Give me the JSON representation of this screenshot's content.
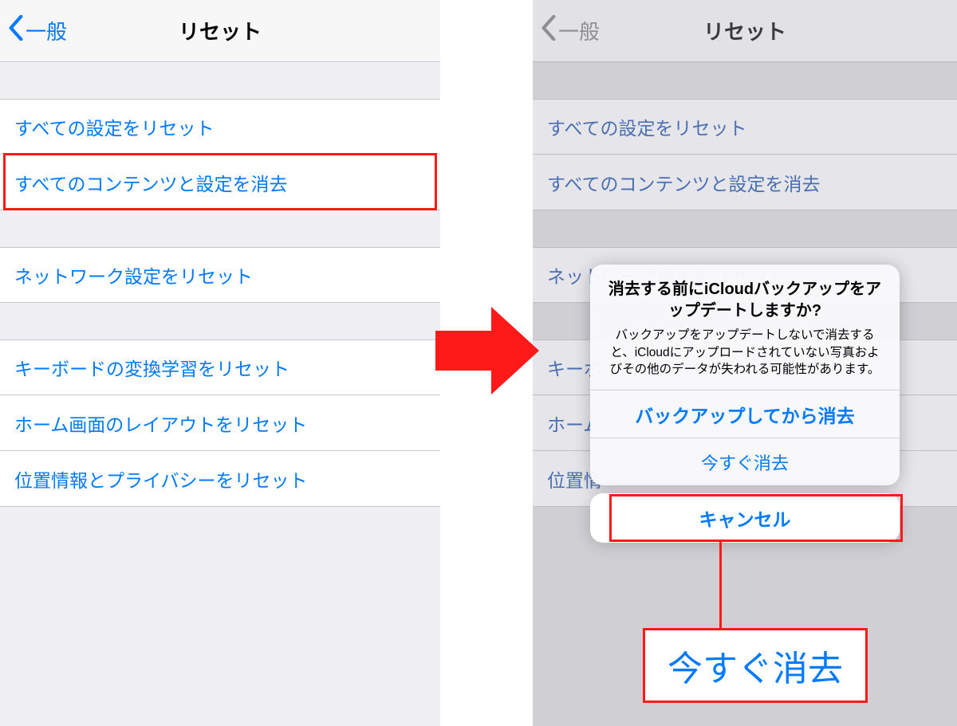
{
  "left": {
    "back_label": "一般",
    "title": "リセット",
    "group1": [
      "すべての設定をリセット",
      "すべてのコンテンツと設定を消去"
    ],
    "group2": [
      "ネットワーク設定をリセット"
    ],
    "group3": [
      "キーボードの変換学習をリセット",
      "ホーム画面のレイアウトをリセット",
      "位置情報とプライバシーをリセット"
    ]
  },
  "right": {
    "back_label": "一般",
    "title": "リセット",
    "group1": [
      "すべての設定をリセット",
      "すべてのコンテンツと設定を消去"
    ],
    "group2": [
      "ネットワーク設定をリセット"
    ],
    "group3_prefix": [
      "キーボ",
      "ホーム",
      "位置情"
    ],
    "sheet": {
      "title": "消去する前にiCloudバックアップをアップデートしますか?",
      "message": "バックアップをアップデートしないで消去すると、iCloudにアップロードされていない写真およびその他のデータが失われる可能性があります。",
      "backup": "バックアップしてから消去",
      "erase": "今すぐ消去",
      "cancel": "キャンセル"
    },
    "callout": "今すぐ消去"
  }
}
